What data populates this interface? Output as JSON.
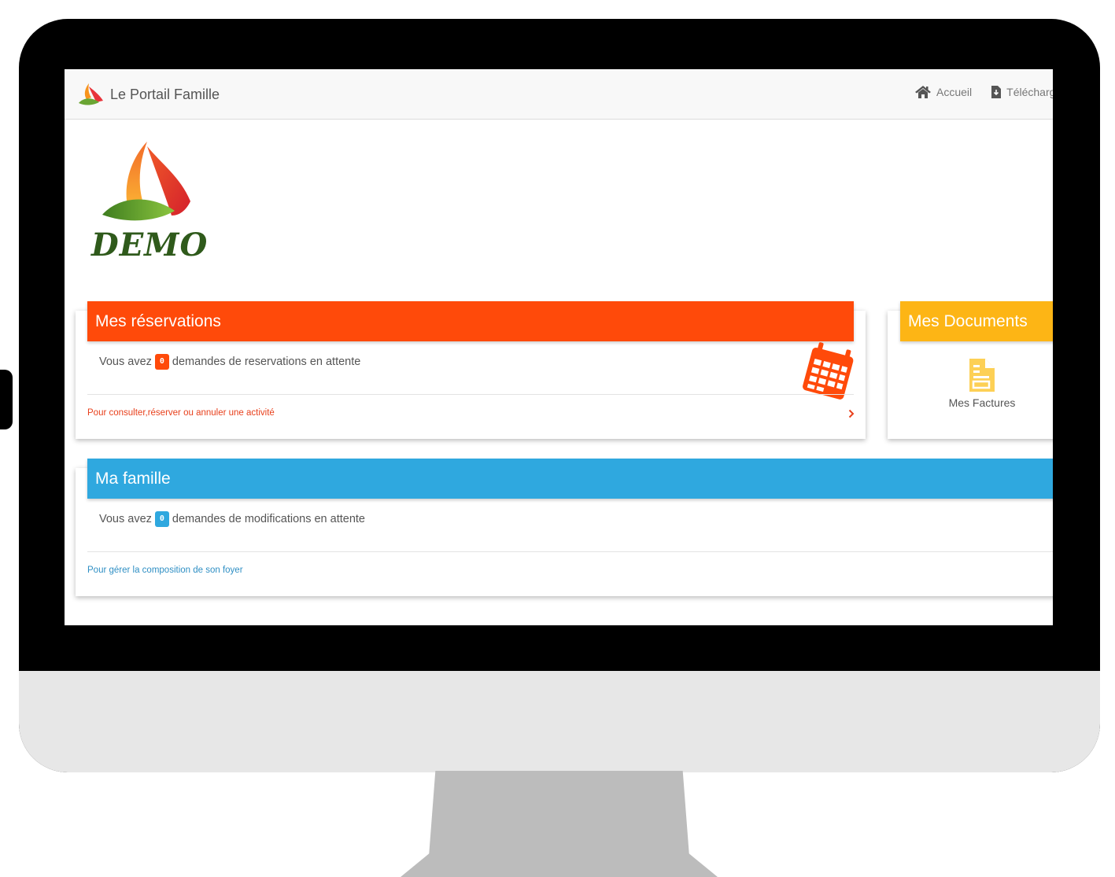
{
  "navbar": {
    "brand_title": "Le Portail Famille",
    "links": [
      {
        "label": "Accueil",
        "icon": "home-icon"
      },
      {
        "label": "Télécharg",
        "icon": "download-icon"
      }
    ]
  },
  "logo": {
    "text": "DEMO"
  },
  "reservations": {
    "title": "Mes réservations",
    "message_before": "Vous avez",
    "count": "0",
    "message_after": "demandes de reservations en attente",
    "link": "Pour consulter,réserver ou annuler une activité",
    "icon": "calendar-icon"
  },
  "documents": {
    "title": "Mes Documents",
    "item_label": "Mes Factures",
    "icon": "document-icon"
  },
  "famille": {
    "title": "Ma famille",
    "message_before": "Vous avez",
    "count": "0",
    "message_after": "demandes de modifications en attente",
    "link": "Pour gérer la composition de son foyer"
  },
  "colors": {
    "reservations": "#ff4a0a",
    "documents": "#fdb515",
    "famille": "#2fa8df"
  }
}
